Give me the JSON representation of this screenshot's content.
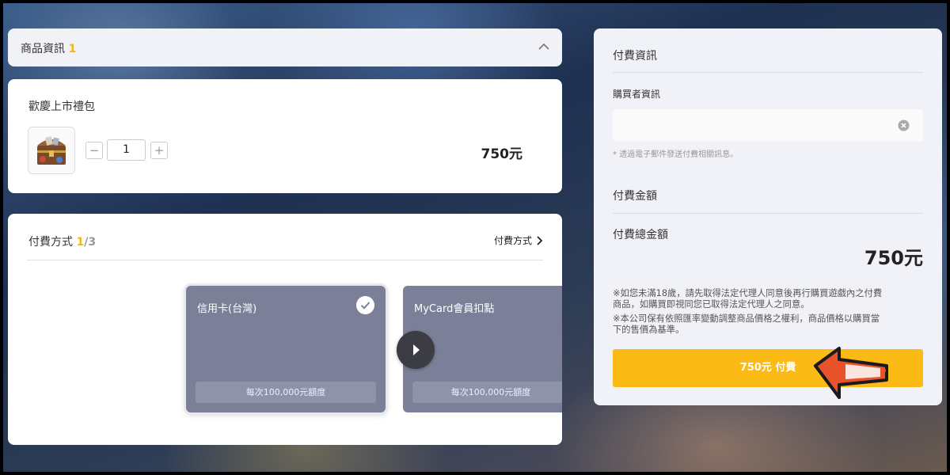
{
  "colors": {
    "accent": "#f5b41a",
    "pay_button": "#fbba16",
    "method_card": "#7b8098",
    "arrow": "#e8532b"
  },
  "product_section": {
    "title": "商品資訊",
    "count": "1"
  },
  "product": {
    "name": "歡慶上市禮包",
    "image": "treasure-chest-icon",
    "quantity": "1",
    "price": "750元"
  },
  "payment_method": {
    "title": "付費方式",
    "current": "1",
    "total": "/3",
    "link_label": "付費方式",
    "methods": [
      {
        "name": "信用卡(台灣)",
        "limit": "每次100,000元額度",
        "selected": true
      },
      {
        "name": "MyCard會員扣點",
        "limit": "每次100,000元額度",
        "selected": false
      }
    ]
  },
  "payment_info": {
    "title": "付費資訊",
    "buyer_label": "購買者資訊",
    "buyer_value": "",
    "hint": "* 透過電子郵件發送付費相關訊息。",
    "amount_title": "付費金額",
    "total_label": "付費總金額",
    "total_value": "750元",
    "notices": [
      "※如您未滿18歲，請先取得法定代理人同意後再行購買遊戲內之付費",
      "商品，如購買即視同您已取得法定代理人之同意。",
      "※本公司保有依照匯率變動調整商品價格之權利，商品價格以購買當",
      "下的售價為基準。"
    ],
    "pay_button_label": "750元 付費"
  }
}
